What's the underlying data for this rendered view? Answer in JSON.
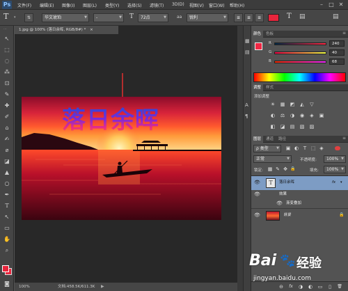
{
  "app": {
    "logo": "Ps"
  },
  "menu": {
    "items": [
      "文件(F)",
      "编辑(E)",
      "图像(I)",
      "图层(L)",
      "类型(Y)",
      "选择(S)",
      "滤镜(T)",
      "3D(D)",
      "视图(V)",
      "窗口(W)",
      "帮助(H)"
    ]
  },
  "window_controls": {
    "minimize": "–",
    "restore": "□",
    "close": "✕"
  },
  "options": {
    "tool_glyph": "T",
    "orient_glyph": "⇅",
    "font_family": "华文琥珀",
    "font_style": "-",
    "size_glyph": "T",
    "font_size": "72点",
    "aa_glyph": "aa",
    "antialias": "锐利",
    "align_left": "≡",
    "align_center": "≡",
    "align_right": "≡",
    "text_color": "#e8253c",
    "warp": "T",
    "panels": "▤",
    "workspace": "▤"
  },
  "document": {
    "tab_title": "1.jpg @ 100% (落日余晖, RGB/8#) *",
    "tab_close": "×",
    "overlay_text": "落日余晖",
    "arrow_color": "#e03030"
  },
  "status": {
    "zoom": "100%",
    "doc_info": "文档:458.5K/611.3K"
  },
  "color_panel": {
    "tabs": [
      "颜色",
      "色板"
    ],
    "r": {
      "label": "R",
      "value": "240"
    },
    "g": {
      "label": "G",
      "value": "40"
    },
    "b": {
      "label": "B",
      "value": "68"
    },
    "fg": "#f02844"
  },
  "adjust_panel": {
    "tabs": [
      "调整",
      "样式"
    ],
    "title": "添加调整",
    "icons": [
      "☀",
      "▦",
      "◩",
      "◭",
      "▽",
      "◐",
      "⚖",
      "◑",
      "◉",
      "◈",
      "▣",
      "◧",
      "◪",
      "▤",
      "▧",
      "▨",
      "▥",
      "◫"
    ]
  },
  "layers_panel": {
    "tabs": [
      "图层",
      "通道",
      "路径"
    ],
    "kind_label": "ρ 类型",
    "filter_icons": [
      "▣",
      "◐",
      "T",
      "⬚",
      "◈"
    ],
    "blend_mode": "正常",
    "opacity_label": "不透明度:",
    "opacity": "100%",
    "lock_label": "锁定:",
    "lock_icons": [
      "▦",
      "✎",
      "✥",
      "🔒"
    ],
    "fill_label": "填充:",
    "fill": "100%",
    "layers": [
      {
        "name": "落日余晖",
        "type": "text",
        "fx": "fx",
        "thumb": "T"
      },
      {
        "name": "效果",
        "type": "effect"
      },
      {
        "name": "渐变叠加",
        "type": "effect-item"
      },
      {
        "name": "背景",
        "type": "image",
        "lock": "🔒"
      }
    ],
    "bottom_icons": [
      "⊖",
      "fx",
      "◑",
      "◐",
      "▭",
      "▯",
      "🗑"
    ]
  },
  "watermark": {
    "brand": "Bai",
    "paw": "🐾",
    "brand2": "经验",
    "url": "jingyan.baidu.com"
  },
  "tools": [
    "⬚",
    "⬚",
    "◌",
    "⁂",
    "⊡",
    "✎",
    "✚",
    "✐",
    "⌂",
    "✍",
    "⌀",
    "◪",
    "▲",
    "○",
    "✒",
    "T",
    "↖",
    "▭",
    "✋",
    "⌕"
  ],
  "tool_extra": "⋯"
}
